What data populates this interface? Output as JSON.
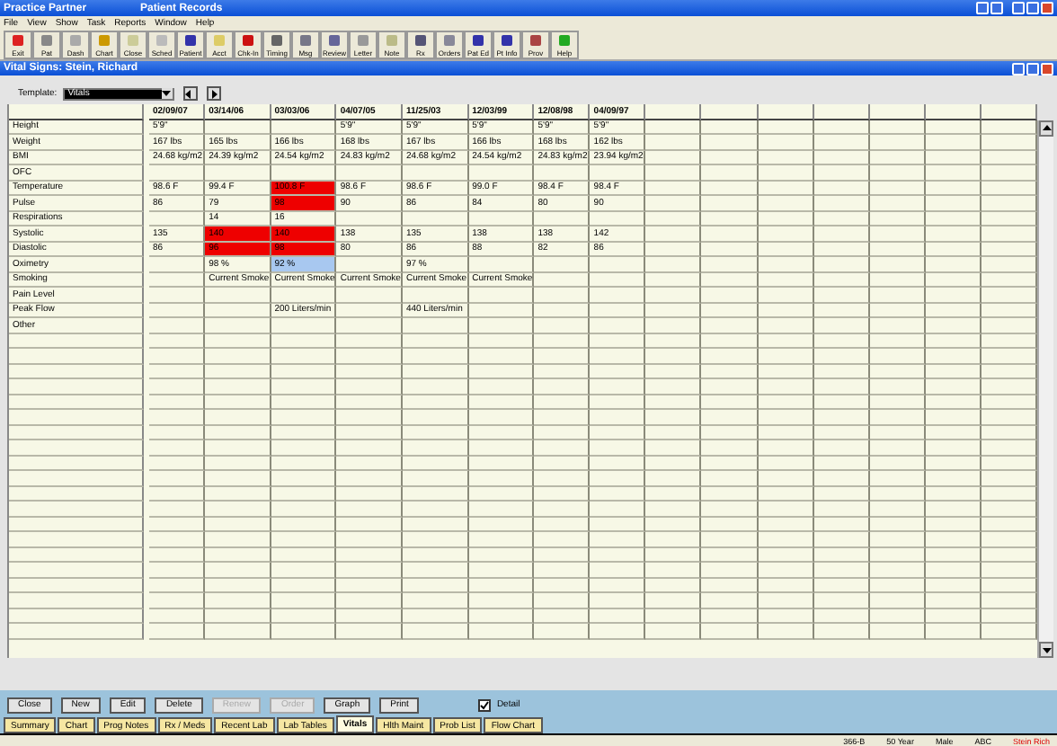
{
  "app_window": {
    "title": "Practice Partner",
    "subtitle": "Patient Records"
  },
  "menu": [
    "File",
    "View",
    "Show",
    "Task",
    "Reports",
    "Window",
    "Help"
  ],
  "toolbar": [
    "Exit",
    "Pat",
    "Dash",
    "Chart",
    "Close",
    "Sched",
    "Patient",
    "Acct",
    "Chk-In",
    "Timing",
    "Msg",
    "Review",
    "Letter",
    "Note",
    "Rx",
    "Orders",
    "Pat Ed",
    "Pt Info",
    "Prov",
    "Help"
  ],
  "child_window": {
    "title": "Vital Signs: Stein, Richard"
  },
  "template": {
    "label": "Template:",
    "value": "Vitals"
  },
  "table": {
    "columns": [
      "02/09/07",
      "03/14/06",
      "03/03/06",
      "04/07/05",
      "11/25/03",
      "12/03/99",
      "12/08/98",
      "04/09/97"
    ],
    "rows": [
      {
        "label": "Height",
        "cells": [
          {
            "text": "5'9\""
          },
          {},
          {},
          {
            "text": "5'9\""
          },
          {
            "text": "5'9\""
          },
          {
            "text": "5'9\""
          },
          {
            "text": "5'9\""
          },
          {
            "text": "5'9\""
          }
        ]
      },
      {
        "label": "Weight",
        "cells": [
          {
            "text": "167 lbs"
          },
          {
            "text": "165 lbs"
          },
          {
            "text": "166 lbs"
          },
          {
            "text": "168 lbs"
          },
          {
            "text": "167 lbs"
          },
          {
            "text": "166 lbs"
          },
          {
            "text": "168 lbs"
          },
          {
            "text": "162 lbs"
          }
        ]
      },
      {
        "label": "BMI",
        "cells": [
          {
            "text": "24.68 kg/m2"
          },
          {
            "text": "24.39 kg/m2"
          },
          {
            "text": "24.54 kg/m2"
          },
          {
            "text": "24.83 kg/m2"
          },
          {
            "text": "24.68 kg/m2"
          },
          {
            "text": "24.54 kg/m2"
          },
          {
            "text": "24.83 kg/m2"
          },
          {
            "text": "23.94 kg/m2"
          }
        ]
      },
      {
        "label": "OFC",
        "cells": []
      },
      {
        "label": "Temperature",
        "cells": [
          {
            "text": "98.6 F"
          },
          {
            "text": "99.4 F"
          },
          {
            "text": "100.8 F",
            "color": "#ee0000"
          },
          {
            "text": "98.6 F"
          },
          {
            "text": "98.6 F"
          },
          {
            "text": "99.0 F"
          },
          {
            "text": "98.4 F"
          },
          {
            "text": "98.4 F"
          }
        ]
      },
      {
        "label": "Pulse",
        "cells": [
          {
            "text": "86"
          },
          {
            "text": "79"
          },
          {
            "text": "98",
            "color": "#ee0000"
          },
          {
            "text": "90"
          },
          {
            "text": "86"
          },
          {
            "text": "84"
          },
          {
            "text": "80"
          },
          {
            "text": "90"
          }
        ]
      },
      {
        "label": "Respirations",
        "cells": [
          {},
          {
            "text": "14"
          },
          {
            "text": "16"
          }
        ]
      },
      {
        "label": "Systolic",
        "cells": [
          {
            "text": "135"
          },
          {
            "text": "140",
            "color": "#ee0000"
          },
          {
            "text": "140",
            "color": "#ee0000"
          },
          {
            "text": "138"
          },
          {
            "text": "135"
          },
          {
            "text": "138"
          },
          {
            "text": "138"
          },
          {
            "text": "142"
          }
        ]
      },
      {
        "label": "Diastolic",
        "cells": [
          {
            "text": "86"
          },
          {
            "text": "96",
            "color": "#ee0000"
          },
          {
            "text": "98",
            "color": "#ee0000"
          },
          {
            "text": "80"
          },
          {
            "text": "86"
          },
          {
            "text": "88"
          },
          {
            "text": "82"
          },
          {
            "text": "86"
          }
        ]
      },
      {
        "label": "Oximetry",
        "cells": [
          {},
          {
            "text": "98 %"
          },
          {
            "text": "92 %",
            "color": "#a8c8f0"
          },
          {},
          {
            "text": "97 %"
          }
        ]
      },
      {
        "label": "Smoking",
        "cells": [
          {},
          {
            "text": "Current Smoke"
          },
          {
            "text": "Current Smoke"
          },
          {
            "text": "Current Smoke"
          },
          {
            "text": "Current Smoke"
          },
          {
            "text": "Current Smoke"
          }
        ]
      },
      {
        "label": "Pain Level",
        "cells": []
      },
      {
        "label": "Peak Flow",
        "cells": [
          {},
          {},
          {
            "text": "200 Liters/min"
          },
          {},
          {
            "text": "440 Liters/min"
          }
        ]
      },
      {
        "label": "Other",
        "cells": []
      }
    ]
  },
  "buttons": [
    {
      "label": "Close",
      "disabled": false
    },
    {
      "label": "New",
      "disabled": false
    },
    {
      "label": "Edit",
      "disabled": false
    },
    {
      "label": "Delete",
      "disabled": false
    },
    {
      "label": "Renew",
      "disabled": true
    },
    {
      "label": "Order",
      "disabled": true
    },
    {
      "label": "Graph",
      "disabled": false
    },
    {
      "label": "Print",
      "disabled": false
    }
  ],
  "detail": {
    "label": "Detail",
    "checked": true
  },
  "tabs": [
    {
      "label": "Summary",
      "selected": false
    },
    {
      "label": "Chart",
      "selected": false
    },
    {
      "label": "Prog Notes",
      "selected": false
    },
    {
      "label": "Rx / Meds",
      "selected": false
    },
    {
      "label": "Recent Lab",
      "selected": false
    },
    {
      "label": "Lab Tables",
      "selected": false
    },
    {
      "label": "Vitals",
      "selected": true
    },
    {
      "label": "Hlth Maint",
      "selected": false
    },
    {
      "label": "Prob List",
      "selected": false
    },
    {
      "label": "Flow Chart",
      "selected": false
    }
  ],
  "status_bar": [
    {
      "text": "366-B",
      "kind": "plain"
    },
    {
      "text": "50 Year",
      "kind": "plain"
    },
    {
      "text": "Male",
      "kind": "plain"
    },
    {
      "text": "ABC",
      "kind": "plain"
    },
    {
      "text": "Stein Rich",
      "kind": "alert"
    }
  ]
}
